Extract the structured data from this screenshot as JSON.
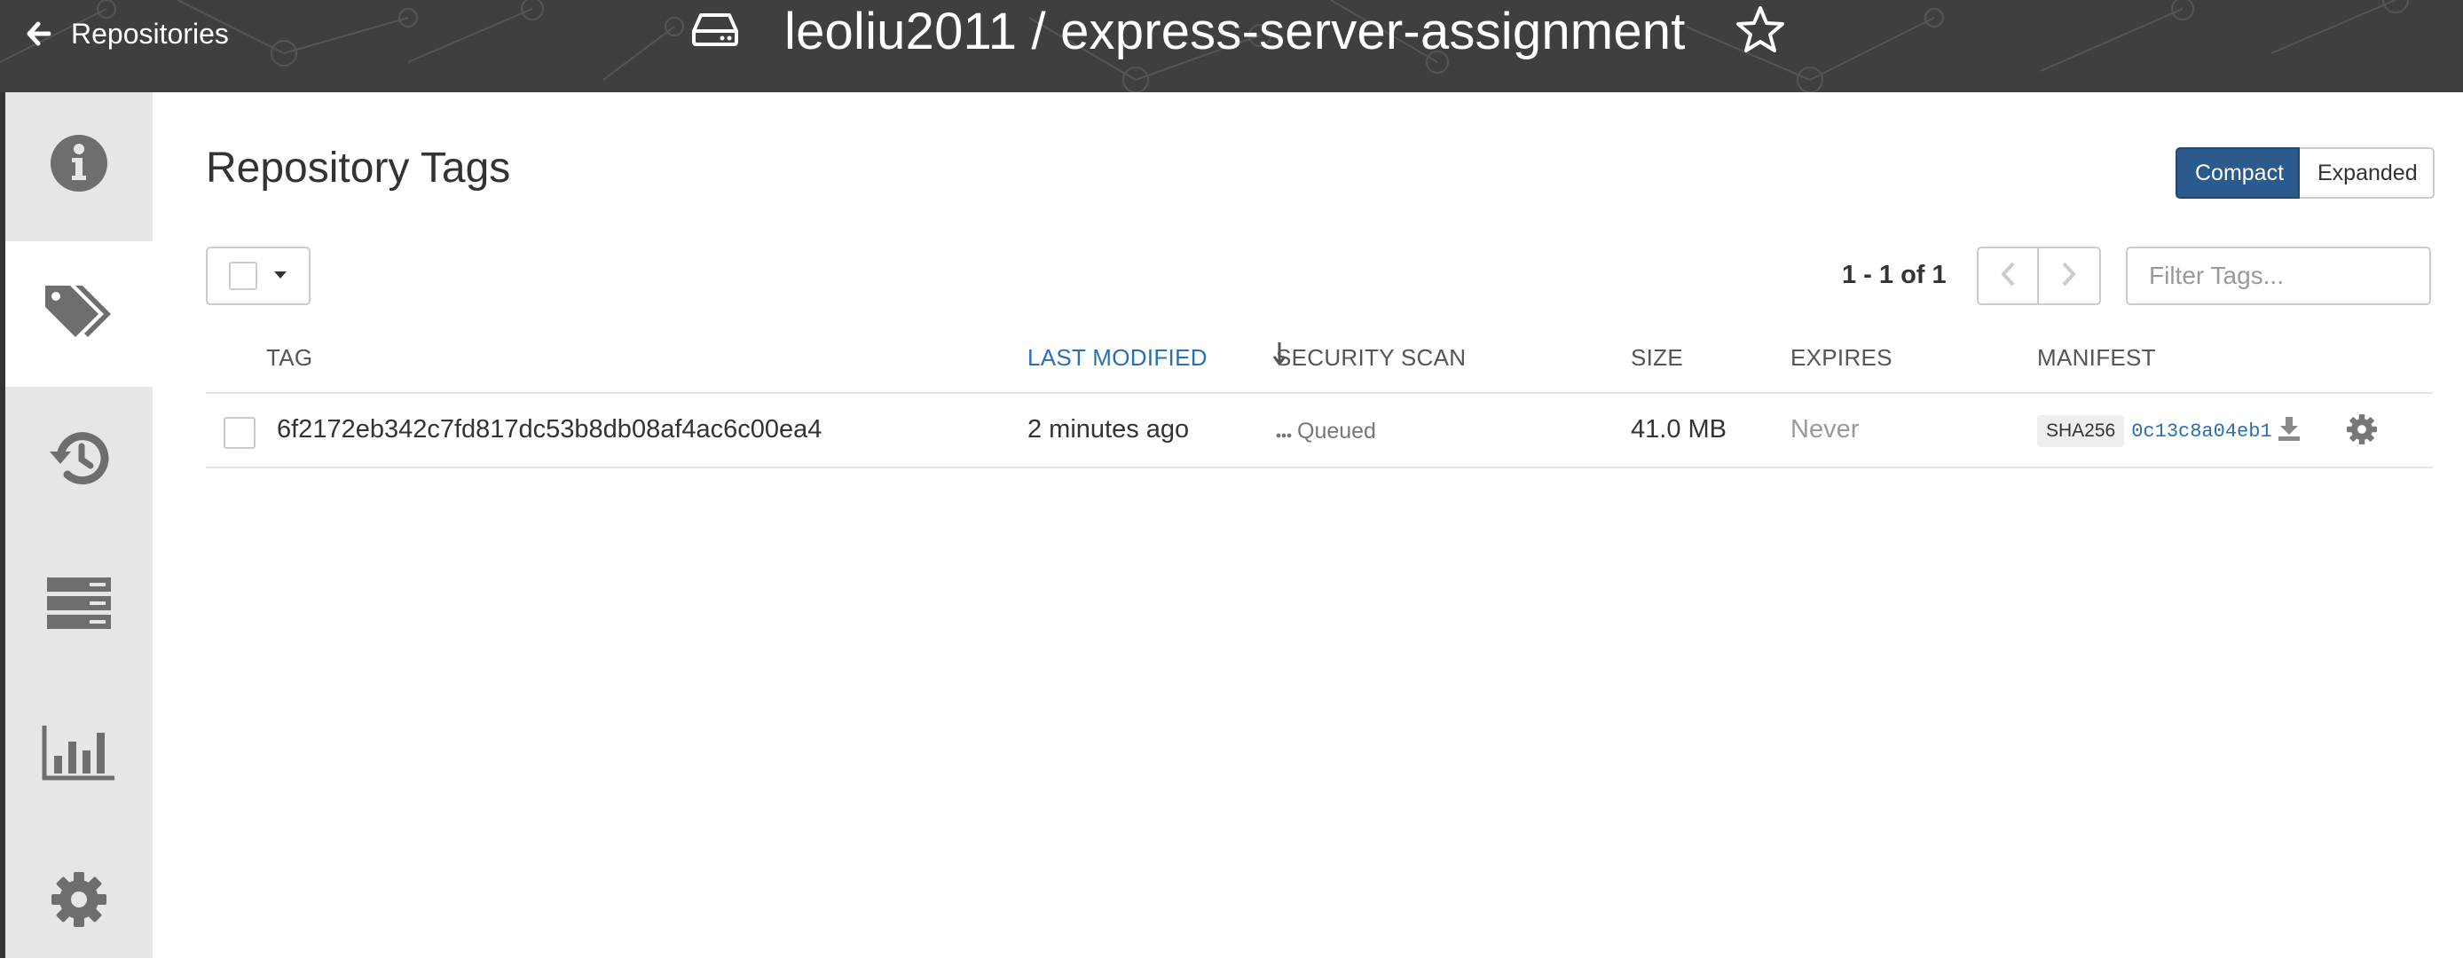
{
  "header": {
    "back_label": "Repositories",
    "repo_title": "leoliu2011 / express-server-assignment"
  },
  "sidebar": {
    "items": [
      {
        "name": "information",
        "icon": "info-icon",
        "active": false
      },
      {
        "name": "tags",
        "icon": "tags-icon",
        "active": true
      },
      {
        "name": "history",
        "icon": "history-icon",
        "active": false
      },
      {
        "name": "builds",
        "icon": "builds-icon",
        "active": false
      },
      {
        "name": "usage-logs",
        "icon": "bar-chart-icon",
        "active": false
      },
      {
        "name": "settings",
        "icon": "gear-icon",
        "active": false
      }
    ]
  },
  "main": {
    "title": "Repository Tags",
    "view_toggle": {
      "compact": "Compact",
      "expanded": "Expanded",
      "selected": "Compact"
    },
    "pagination": {
      "text": "1 - 1 of 1"
    },
    "filter": {
      "placeholder": "Filter Tags..."
    },
    "table": {
      "columns": [
        "TAG",
        "LAST MODIFIED",
        "SECURITY SCAN",
        "SIZE",
        "EXPIRES",
        "MANIFEST"
      ],
      "sorted_column": "LAST MODIFIED",
      "rows": [
        {
          "tag": "6f2172eb342c7fd817dc53b8db08af4ac6c00ea4",
          "last_modified": "2 minutes ago",
          "security_scan": "Queued",
          "size": "41.0 MB",
          "expires": "Never",
          "manifest_algo": "SHA256",
          "manifest_digest": "0c13c8a04eb1"
        }
      ]
    }
  },
  "colors": {
    "header_bg": "#3f3f3f",
    "sidebar_bg": "#e6e6e6",
    "accent": "#2c5a8c",
    "link": "#2a6fb4"
  }
}
